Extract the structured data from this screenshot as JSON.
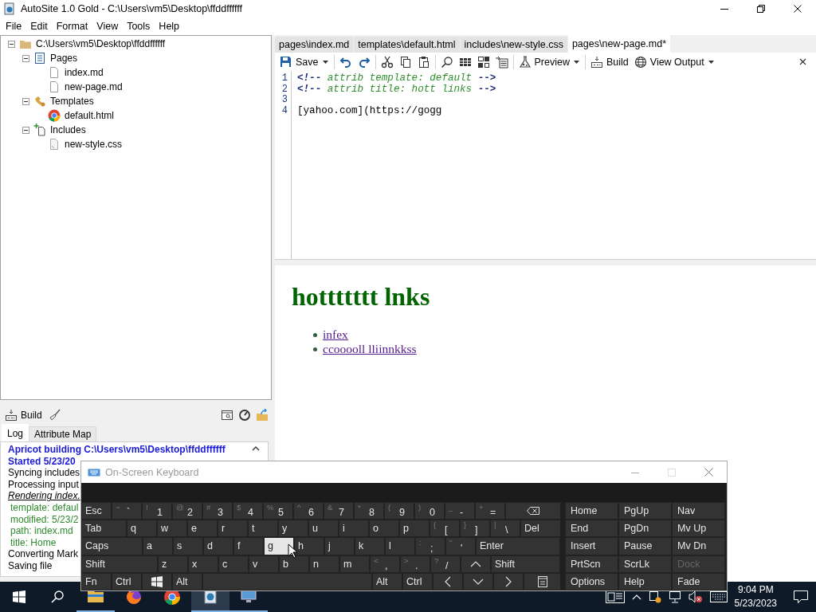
{
  "window": {
    "title": "AutoSite 1.0 Gold - C:\\Users\\vm5\\Desktop\\ffddffffff"
  },
  "menu": [
    "File",
    "Edit",
    "Format",
    "View",
    "Tools",
    "Help"
  ],
  "tree": [
    {
      "label": "C:\\Users\\vm5\\Desktop\\ffddffffff",
      "kind": "folder",
      "expanded": true,
      "children": [
        {
          "label": "Pages",
          "kind": "pages",
          "expanded": true,
          "children": [
            {
              "label": "index.md",
              "kind": "file"
            },
            {
              "label": "new-page.md",
              "kind": "file"
            }
          ]
        },
        {
          "label": "Templates",
          "kind": "templates",
          "expanded": true,
          "children": [
            {
              "label": "default.html",
              "kind": "browser"
            }
          ]
        },
        {
          "label": "Includes",
          "kind": "includes",
          "expanded": true,
          "children": [
            {
              "label": "new-style.css",
              "kind": "stylesheet"
            }
          ]
        }
      ]
    }
  ],
  "build_panel": {
    "build_label": "Build",
    "tabs": [
      {
        "label": "Log",
        "selected": true
      },
      {
        "label": "Attribute Map",
        "selected": false
      }
    ],
    "log": [
      {
        "text": "Apricot building C:\\Users\\vm5\\Desktop\\ffddffffff",
        "kind": "heading"
      },
      {
        "text": "Started 5/23/20",
        "kind": "heading"
      },
      {
        "text": "Syncing includes",
        "kind": "plain"
      },
      {
        "text": "Processing input",
        "kind": "plain"
      },
      {
        "text": "Rendering index.",
        "kind": "italic"
      },
      {
        "text": "template: defaul",
        "kind": "detail"
      },
      {
        "text": "modified: 5/23/2",
        "kind": "detail"
      },
      {
        "text": "path: index.md",
        "kind": "detail"
      },
      {
        "text": "title: Home",
        "kind": "detail"
      },
      {
        "text": "Converting Mark",
        "kind": "plain"
      },
      {
        "text": "Saving file",
        "kind": "plain"
      }
    ]
  },
  "editor_tabs": [
    {
      "label": "pages\\index.md",
      "selected": false
    },
    {
      "label": "templates\\default.html",
      "selected": false
    },
    {
      "label": "includes\\new-style.css",
      "selected": false
    },
    {
      "label": "pages\\new-page.md*",
      "selected": true
    }
  ],
  "toolbar": {
    "save": "Save",
    "preview": "Preview",
    "build": "Build",
    "view_output": "View Output"
  },
  "editor": {
    "lines": [
      {
        "number": "1",
        "kind": "comment",
        "open": "<!--",
        "text": "attrib template: default",
        "close": "-->"
      },
      {
        "number": "2",
        "kind": "comment",
        "open": "<!--",
        "text": "attrib title: hott links",
        "close": "-->"
      },
      {
        "number": "3",
        "kind": "blank"
      },
      {
        "number": "4",
        "kind": "text",
        "text": "[yahoo.com](https://gogg"
      }
    ]
  },
  "preview": {
    "heading": "hottttttt lnks",
    "links": [
      "infex",
      "ccooooll lliinnkkss"
    ]
  },
  "keyboard": {
    "title": "On-Screen Keyboard",
    "rows": [
      [
        {
          "kind": "std",
          "label": "Esc",
          "highlighted": false
        },
        {
          "kind": "std",
          "top": "~",
          "label": "`",
          "highlighted": false
        },
        {
          "kind": "std",
          "top": "!",
          "label": "1",
          "highlighted": false
        },
        {
          "kind": "std",
          "top": "@",
          "label": "2",
          "highlighted": false
        },
        {
          "kind": "std",
          "top": "#",
          "label": "3",
          "highlighted": false
        },
        {
          "kind": "std",
          "top": "$",
          "label": "4",
          "highlighted": false
        },
        {
          "kind": "std",
          "top": "%",
          "label": "5",
          "highlighted": false
        },
        {
          "kind": "std",
          "top": "^",
          "label": "6",
          "highlighted": false
        },
        {
          "kind": "std",
          "top": "&",
          "label": "7",
          "highlighted": false
        },
        {
          "kind": "std",
          "top": "*",
          "label": "8",
          "highlighted": false
        },
        {
          "kind": "std",
          "top": "(",
          "label": "9",
          "highlighted": false
        },
        {
          "kind": "std",
          "top": ")",
          "label": "0",
          "highlighted": false
        },
        {
          "kind": "std",
          "top": "_",
          "label": "-",
          "highlighted": false
        },
        {
          "kind": "std",
          "top": "+",
          "label": "=",
          "highlighted": false
        },
        {
          "kind": "bksp",
          "highlighted": false
        }
      ],
      [
        {
          "kind": "tab",
          "label": "Tab",
          "highlighted": false
        },
        {
          "kind": "std",
          "label": "q",
          "highlighted": false
        },
        {
          "kind": "std",
          "label": "w",
          "highlighted": false
        },
        {
          "kind": "std",
          "label": "e",
          "highlighted": false
        },
        {
          "kind": "std",
          "label": "r",
          "highlighted": false
        },
        {
          "kind": "std",
          "label": "t",
          "highlighted": false
        },
        {
          "kind": "std",
          "label": "y",
          "highlighted": false
        },
        {
          "kind": "std",
          "label": "u",
          "highlighted": false
        },
        {
          "kind": "std",
          "label": "i",
          "highlighted": false
        },
        {
          "kind": "std",
          "label": "o",
          "highlighted": false
        },
        {
          "kind": "std",
          "label": "p",
          "highlighted": false
        },
        {
          "kind": "std",
          "top": "{",
          "label": "[",
          "highlighted": false
        },
        {
          "kind": "std",
          "top": "}",
          "label": "]",
          "highlighted": false
        },
        {
          "kind": "std",
          "top": "|",
          "label": "\\",
          "highlighted": false
        },
        {
          "kind": "del",
          "label": "Del",
          "highlighted": false
        }
      ],
      [
        {
          "kind": "caps",
          "label": "Caps",
          "highlighted": false
        },
        {
          "kind": "std",
          "label": "a",
          "highlighted": false
        },
        {
          "kind": "std",
          "label": "s",
          "highlighted": false
        },
        {
          "kind": "std",
          "label": "d",
          "highlighted": false
        },
        {
          "kind": "std",
          "label": "f",
          "highlighted": false
        },
        {
          "kind": "std",
          "label": "g",
          "highlighted": true
        },
        {
          "kind": "std",
          "label": "h",
          "highlighted": false
        },
        {
          "kind": "std",
          "label": "j",
          "highlighted": false
        },
        {
          "kind": "std",
          "label": "k",
          "highlighted": false
        },
        {
          "kind": "std",
          "label": "l",
          "highlighted": false
        },
        {
          "kind": "std",
          "top": ":",
          "label": ";",
          "highlighted": false
        },
        {
          "kind": "std",
          "top": "\"",
          "label": "'",
          "highlighted": false
        },
        {
          "kind": "enter",
          "label": "Enter",
          "highlighted": false
        }
      ],
      [
        {
          "kind": "lshift",
          "label": "Shift",
          "highlighted": false
        },
        {
          "kind": "std",
          "label": "z",
          "highlighted": false
        },
        {
          "kind": "std",
          "label": "x",
          "highlighted": false
        },
        {
          "kind": "std",
          "label": "c",
          "highlighted": false
        },
        {
          "kind": "std",
          "label": "v",
          "highlighted": false
        },
        {
          "kind": "std",
          "label": "b",
          "highlighted": false
        },
        {
          "kind": "std",
          "label": "n",
          "highlighted": false
        },
        {
          "kind": "std",
          "label": "m",
          "highlighted": false
        },
        {
          "kind": "std",
          "top": "<",
          "label": ",",
          "highlighted": false
        },
        {
          "kind": "std",
          "top": ">",
          "label": ".",
          "highlighted": false
        },
        {
          "kind": "std",
          "top": "?",
          "label": "/",
          "highlighted": false
        },
        {
          "kind": "up",
          "highlighted": false
        },
        {
          "kind": "rshift",
          "label": "Shift",
          "highlighted": false
        }
      ],
      [
        {
          "kind": "std",
          "label": "Fn",
          "highlighted": false
        },
        {
          "kind": "std",
          "label": "Ctrl",
          "highlighted": false
        },
        {
          "kind": "win",
          "highlighted": false
        },
        {
          "kind": "std",
          "label": "Alt",
          "highlighted": false
        },
        {
          "kind": "space",
          "highlighted": false
        },
        {
          "kind": "std",
          "label": "Alt",
          "highlighted": false
        },
        {
          "kind": "std",
          "label": "Ctrl",
          "highlighted": false
        },
        {
          "kind": "left",
          "highlighted": false
        },
        {
          "kind": "down",
          "highlighted": false
        },
        {
          "kind": "right",
          "highlighted": false
        },
        {
          "kind": "menu",
          "highlighted": false
        }
      ]
    ],
    "nav": [
      [
        {
          "label": "Home",
          "disabled": false
        },
        {
          "label": "PgUp",
          "disabled": false
        },
        {
          "label": "Nav",
          "disabled": false
        }
      ],
      [
        {
          "label": "End",
          "disabled": false
        },
        {
          "label": "PgDn",
          "disabled": false
        },
        {
          "label": "Mv Up",
          "disabled": false
        }
      ],
      [
        {
          "label": "Insert",
          "disabled": false
        },
        {
          "label": "Pause",
          "disabled": false
        },
        {
          "label": "Mv Dn",
          "disabled": false
        }
      ],
      [
        {
          "label": "PrtScn",
          "disabled": false
        },
        {
          "label": "ScrLk",
          "disabled": false
        },
        {
          "label": "Dock",
          "disabled": true
        }
      ],
      [
        {
          "label": "Options",
          "disabled": false
        },
        {
          "label": "Help",
          "disabled": false
        },
        {
          "label": "Fade",
          "disabled": false
        }
      ]
    ]
  },
  "taskbar": {
    "apps": [
      {
        "kind": "folder",
        "running": true,
        "active": false
      },
      {
        "kind": "firefox",
        "running": false,
        "active": false
      },
      {
        "kind": "chrome",
        "running": false,
        "active": false
      },
      {
        "kind": "autosite",
        "running": true,
        "active": true
      },
      {
        "kind": "remote",
        "running": true,
        "active": false
      }
    ],
    "time": "9:04 PM",
    "date": "5/23/2023"
  }
}
